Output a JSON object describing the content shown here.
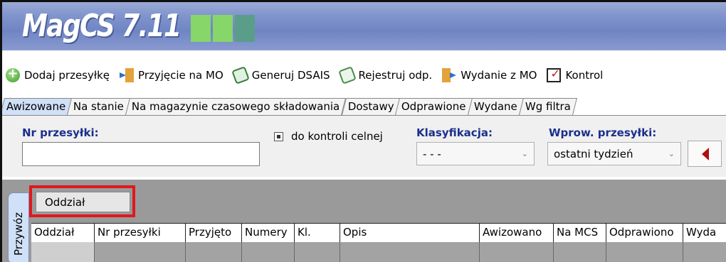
{
  "app": {
    "title": "MagCS 7.11",
    "block_colors": [
      "#86d66a",
      "#86d66a",
      "#5a9e8a"
    ]
  },
  "toolbar": {
    "items": [
      {
        "label": "Dodaj przesyłkę",
        "icon": "add-circle-icon"
      },
      {
        "label": "Przyjęcie na MO",
        "icon": "inbound-package-icon"
      },
      {
        "label": "Generuj DSAIS",
        "icon": "generate-document-icon"
      },
      {
        "label": "Rejestruj odp.",
        "icon": "register-response-icon"
      },
      {
        "label": "Wydanie z MO",
        "icon": "outbound-package-icon"
      },
      {
        "label": "Kontrol",
        "icon": "control-book-icon"
      }
    ]
  },
  "tabs": [
    {
      "label": "Awizowane",
      "active": true
    },
    {
      "label": "Na stanie",
      "active": false
    },
    {
      "label": "Na magazynie czasowego składowania",
      "active": false
    },
    {
      "label": "Dostawy",
      "active": false
    },
    {
      "label": "Odprawione",
      "active": false
    },
    {
      "label": "Wydane",
      "active": false
    },
    {
      "label": "Wg filtra",
      "active": false
    }
  ],
  "filters": {
    "nr_label": "Nr przesyłki:",
    "nr_value": "",
    "checkbox_label": "do kontroli celnej",
    "klasyfikacja_label": "Klasyfikacja:",
    "klasyfikacja_value": "- - -",
    "wprow_label": "Wprow. przesyłki:",
    "wprow_value": "ostatni tydzień"
  },
  "grid": {
    "side_tab_label": "Przywóz",
    "group_by_label": "Oddział",
    "columns": [
      "Oddział",
      "Nr przesyłki",
      "Przyjęto",
      "Numery",
      "Kl.",
      "Opis",
      "Awizowano",
      "Na MCS",
      "Odprawiono",
      "Wyda"
    ]
  },
  "colors": {
    "label_blue": "#1b2f8c",
    "highlight_red": "#e0181c",
    "active_tab": "#cfe0f7"
  }
}
